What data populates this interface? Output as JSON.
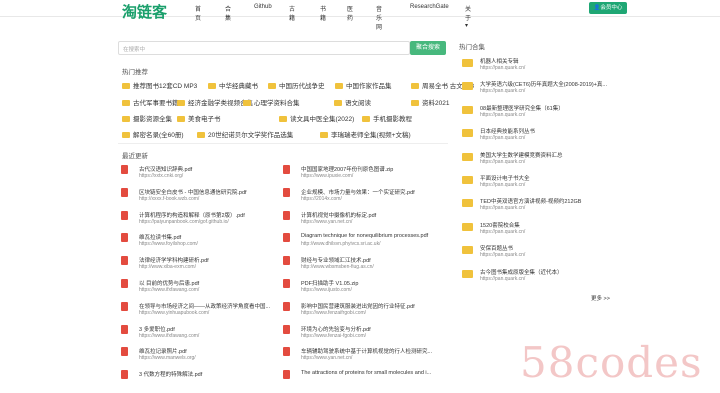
{
  "nav": {
    "logo": "淘链客",
    "links": [
      "首页",
      "合集",
      "Github",
      "古籍",
      "书籍",
      "医药",
      "音乐网",
      "ResearchGate",
      "关于 ▾"
    ],
    "login": "会员中心"
  },
  "search": {
    "placeholder": "在搜索中",
    "button": "聚合搜索"
  },
  "hot": {
    "title": "热门推荐",
    "tags": [
      "推荐图书12套CD MP3",
      "中华经典藏书",
      "中国历代战争史",
      "中国作家作品集",
      "周易全书 古文 1-8",
      "古代军事要书籍",
      "经济金融学类视频合集",
      "心理学资料合集",
      "语文阅读",
      "资料2021",
      "摄影资源全集",
      "美食电子书",
      "读文具中医全集(2022)",
      "手机摄影教程",
      "解密名录(全60册)",
      "20世纪诺贝尔文学奖作品选集",
      "李瑞瑞老师全集(视频+文稿)"
    ]
  },
  "recent": {
    "title": "最近更新",
    "left": [
      {
        "t": "古代汉语知识辞典.pdf",
        "u": "https://xxtx.cnki.org/"
      },
      {
        "t": "区块链安全白皮书 - 中国信息通信研究院.pdf",
        "u": "http://xxxx.f-book.wzb.com/"
      },
      {
        "t": "计算机程序的构造和解释（原书第2版）.pdf",
        "u": "https://paiyunpanbook.com/gof.github.io/"
      },
      {
        "t": "维瓦拉读书集.pdf",
        "u": "https://www.foyilshop.com/"
      },
      {
        "t": "法律经济学学科构建研析.pdf",
        "u": "http://www.xiba-exm.com/"
      },
      {
        "t": "以 目前的优势与后患.pdf",
        "u": "https://www.ifxfawang.com/"
      },
      {
        "t": "在领导与市场经济之间——从政策经济学角度看中国...",
        "u": "https://www.yinhuapubook.com/"
      },
      {
        "t": "3 多爱职位.pdf",
        "u": "https://www.ifxfawang.com/"
      },
      {
        "t": "维瓦拉记录照片.pdf",
        "u": "https://www.manwels.org/"
      },
      {
        "t": "3 代数方程的特殊解法.pdf",
        "u": ""
      }
    ],
    "right": [
      {
        "t": "中国国家地理2007年份刊原色图谱.zip",
        "u": "https://www.ipuxie.com/"
      },
      {
        "t": "企业规模、市场力量与效果：一个实证研究.pdf",
        "u": "https://2014x.com/"
      },
      {
        "t": "计算机视觉中摄像机的标定.pdf",
        "u": "https://www.yan.net.cn/"
      },
      {
        "t": "Diagram technique for nonequilibrium processes.pdf",
        "u": "http://www.dhilsvn.phyivcs.sri.ac.uk/"
      },
      {
        "t": "财经与专业领域汇江技术.pdf",
        "u": "http://www.wbsmsben-fiug.as.cn/"
      },
      {
        "t": "PDF扫描助手 V1.05.zip",
        "u": "https://www.ijusto.com/"
      },
      {
        "t": "影响中国民营建筑服装进出党因的行业特征.pdf",
        "u": "https://www.fenzaifrgobi.com/"
      },
      {
        "t": "环境为心的先验变与分析.pdf",
        "u": "https://www.fenzai-fgobi.com/"
      },
      {
        "t": "车辆辅助驾驶系统中基于计算机视觉的行人检测研究...",
        "u": "https://www.yan.net.cn/"
      },
      {
        "t": "The attractions of proteins for small molecules and i...",
        "u": ""
      }
    ]
  },
  "side": {
    "title": "热门合集",
    "items": [
      {
        "t": "机器人相关专辑",
        "u": "https://pan.quark.cn/"
      },
      {
        "t": "大学英语六级(CET6)历年真题大全(2008-2019)+真...",
        "u": "https://pan.quark.cn/"
      },
      {
        "t": "08最新整理医学研究全集（61集）",
        "u": "https://pan.quark.cn/"
      },
      {
        "t": "日本经典技能系列丛书",
        "u": "https://pan.quark.cn/"
      },
      {
        "t": "美国大学生数学建模竞赛资料汇总",
        "u": "https://pan.quark.cn/"
      },
      {
        "t": "平面设计电子书大全",
        "u": "https://pan.quark.cn/"
      },
      {
        "t": "TED中英双语官方演讲视频-视频约212GB",
        "u": "https://pan.quark.cn/"
      },
      {
        "t": "1520套院校合集",
        "u": "https://pan.quark.cn/"
      },
      {
        "t": "安保百题丛书",
        "u": "https://pan.quark.cn/"
      },
      {
        "t": "古今图书集成原版全集（近代本）",
        "u": "https://pan.quark.cn/"
      }
    ],
    "more": "更多 >>"
  },
  "watermark": "58codes"
}
